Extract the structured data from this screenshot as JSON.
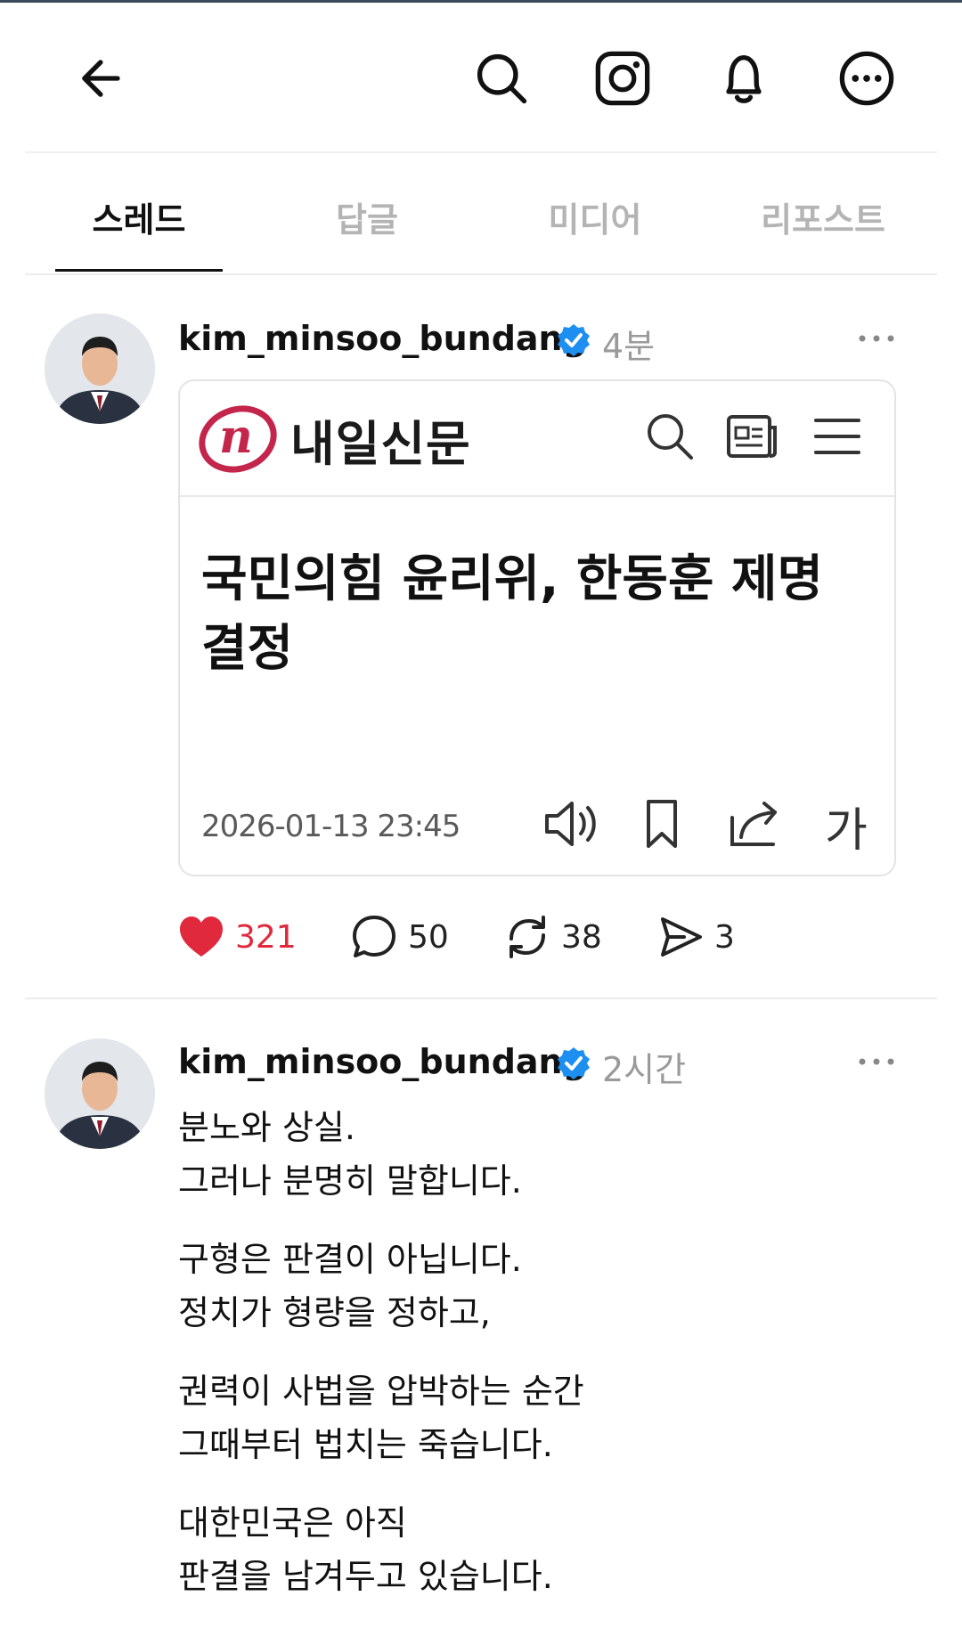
{
  "header": {
    "back_icon": "arrow-left-icon",
    "icons": [
      "search-icon",
      "instagram-icon",
      "bell-icon",
      "more-circle-icon"
    ]
  },
  "tabs": [
    {
      "label": "스레드",
      "active": true
    },
    {
      "label": "답글",
      "active": false
    },
    {
      "label": "미디어",
      "active": false
    },
    {
      "label": "리포스트",
      "active": false
    }
  ],
  "posts": [
    {
      "username": "kim_minsoo_bundang",
      "time": "4분",
      "card": {
        "publisher": "내일신문",
        "headline_line1": "국민의힘 윤리위, 한동훈 제명",
        "headline_line2": "결정",
        "date": "2026-01-13 23:45",
        "font_button": "가"
      },
      "likes": "321",
      "comments": "50",
      "reposts": "38",
      "shares": "3"
    },
    {
      "username": "kim_minsoo_bundang",
      "time": "2시간",
      "paragraphs": [
        [
          "분노와 상실.",
          "그러나 분명히 말합니다."
        ],
        [
          "구형은 판결이 아닙니다.",
          "정치가 형량을 정하고,"
        ],
        [
          "권력이 사법을 압박하는 순간",
          "그때부터 법치는 죽습니다."
        ],
        [
          "대한민국은 아직",
          "판결을 남겨두고 있습니다."
        ]
      ]
    }
  ],
  "colors": {
    "like": "#e0293c",
    "verified": "#1d8ff0",
    "muted": "#9a9a9a",
    "logo": "#c4254a"
  }
}
